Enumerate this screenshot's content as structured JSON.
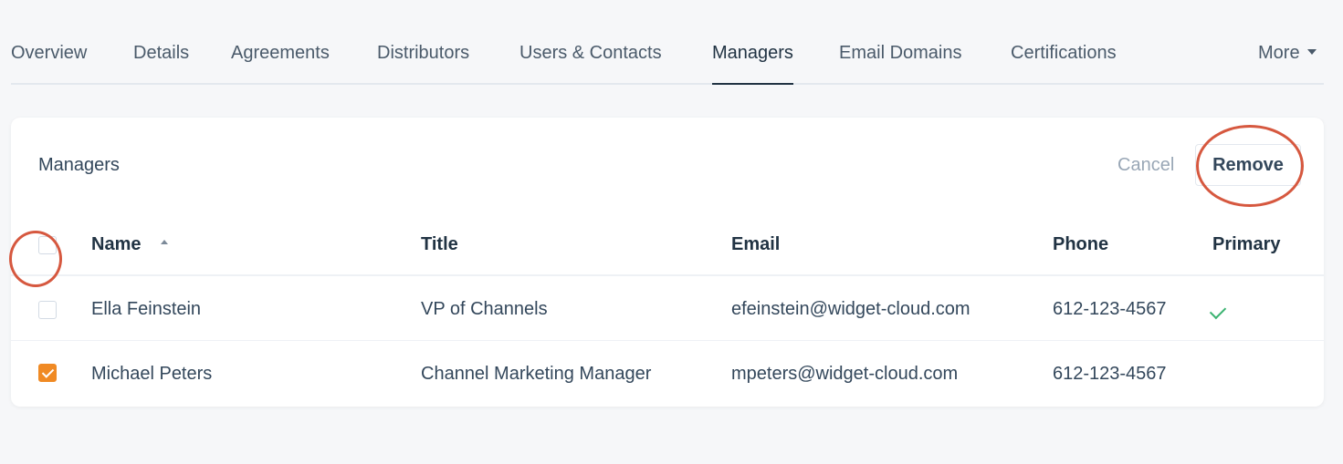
{
  "tabs": [
    {
      "label": "Overview"
    },
    {
      "label": "Details"
    },
    {
      "label": "Agreements"
    },
    {
      "label": "Distributors"
    },
    {
      "label": "Users & Contacts"
    },
    {
      "label": "Managers",
      "active": true
    },
    {
      "label": "Email Domains"
    },
    {
      "label": "Certifications"
    },
    {
      "label": "More"
    }
  ],
  "card": {
    "title": "Managers",
    "cancel_label": "Cancel",
    "remove_label": "Remove"
  },
  "table": {
    "columns": [
      "Name",
      "Title",
      "Email",
      "Phone",
      "Primary"
    ],
    "rows": [
      {
        "name": "Ella Feinstein",
        "title": "VP of Channels",
        "email": "efeinstein@widget-cloud.com",
        "phone": "612-123-4567",
        "primary": true,
        "checked": false
      },
      {
        "name": "Michael Peters",
        "title": "Channel Marketing Manager",
        "email": "mpeters@widget-cloud.com",
        "phone": "612-123-4567",
        "primary": false,
        "checked": true
      }
    ]
  },
  "colors": {
    "accent": "#f08a24",
    "link": "#1f5d8a",
    "annotation": "#d6583f",
    "success": "#3bb371"
  }
}
